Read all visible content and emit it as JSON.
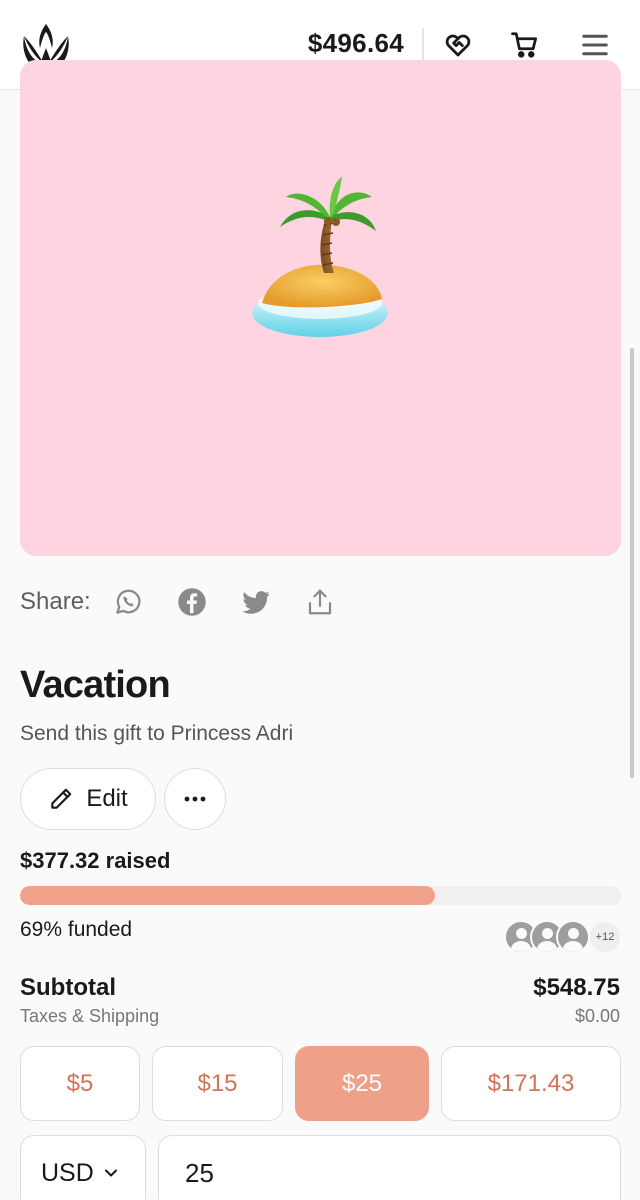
{
  "header": {
    "balance": "$496.64",
    "icons": [
      "crown-logo-icon",
      "heart-handshake-icon",
      "cart-icon",
      "menu-icon"
    ]
  },
  "hero": {
    "background": "#fed4e0",
    "image": "desert-island-emoji"
  },
  "share": {
    "label": "Share:",
    "icons": [
      "whatsapp-icon",
      "facebook-icon",
      "twitter-icon",
      "share-upload-icon"
    ]
  },
  "gift": {
    "title": "Vacation",
    "subtitle": "Send this gift to Princess Adri",
    "edit_label": "Edit",
    "more_icon": "more-horizontal-icon"
  },
  "funding": {
    "raised": "$377.32 raised",
    "progress_fraction": 0.69,
    "funded": "69% funded",
    "contributors_more": "+12",
    "progress_color": "#f0a28a"
  },
  "totals": {
    "subtotal_label": "Subtotal",
    "subtotal_value": "$548.75",
    "taxes_label": "Taxes & Shipping",
    "taxes_value": "$0.00"
  },
  "amounts": {
    "options": [
      "$5",
      "$15",
      "$25",
      "$171.43"
    ],
    "selected": "$25",
    "accent": "#efa089"
  },
  "payment": {
    "currency": "USD",
    "amount_value": "25"
  }
}
